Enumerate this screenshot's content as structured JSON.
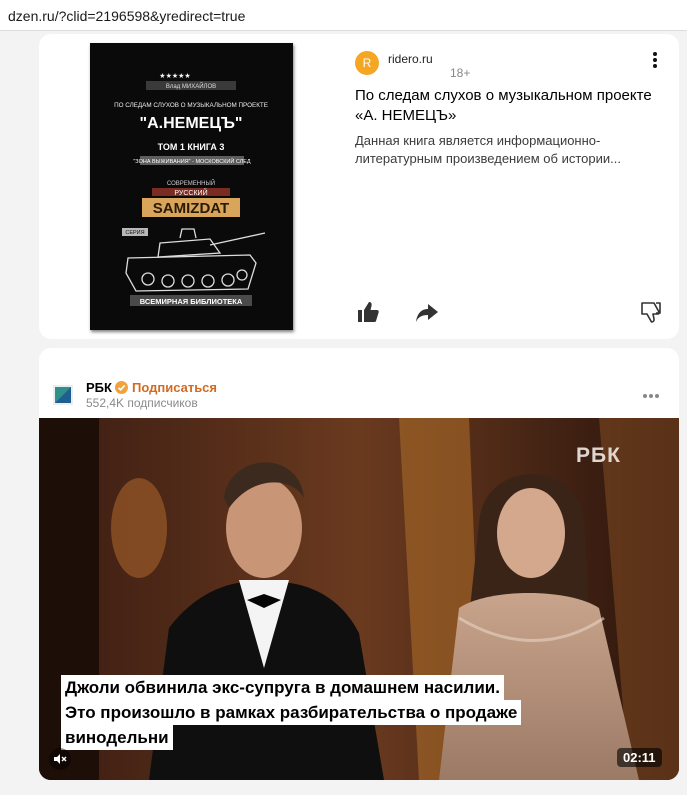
{
  "browser": {
    "url": "dzen.ru/?clid=2196598&yredirect=true"
  },
  "card1": {
    "cover": {
      "author": "Влад МИХАЙЛОВ",
      "line1": "ПО СЛЕДАМ СЛУХОВ О МУЗЫКАЛЬНОМ ПРОЕКТЕ",
      "title": "\"А.НЕМЕЦЪ\"",
      "volume": "ТОМ 1 КНИГА 3",
      "subtitle": "\"ЗОНА ВЫЖИВАНИЯ\" - МОСКОВСКИЙ СЛЕД",
      "modern": "СОВРЕМЕННЫЙ",
      "russian": "РУССКИЙ",
      "samizdat": "SAMIZDAT",
      "series": "СЕРИЯ",
      "library": "ВСЕМИРНАЯ БИБЛИОТЕКА"
    },
    "source": {
      "logo_letter": "R",
      "name": "ridero.ru",
      "age": "18+"
    },
    "title": "По следам слухов о музыкальном проекте «А. НЕМЕЦЪ»",
    "description": "Данная книга является информационно-литературным произведением об истории..."
  },
  "card2": {
    "channel": {
      "name": "РБК",
      "subscribe_label": "Подписаться",
      "subscribers": "552,4K подписчиков"
    },
    "video": {
      "watermark": "РБК",
      "caption_lines": [
        "Джоли обвинила экс-супруга в домашнем насилии.",
        "Это произошло в рамках разбирательства о продаже",
        "винодельни"
      ],
      "duration": "02:11"
    }
  },
  "colors": {
    "subscribe": "#d46a1f",
    "source_logo": "#f5a623",
    "verified": "#f0a23c"
  }
}
